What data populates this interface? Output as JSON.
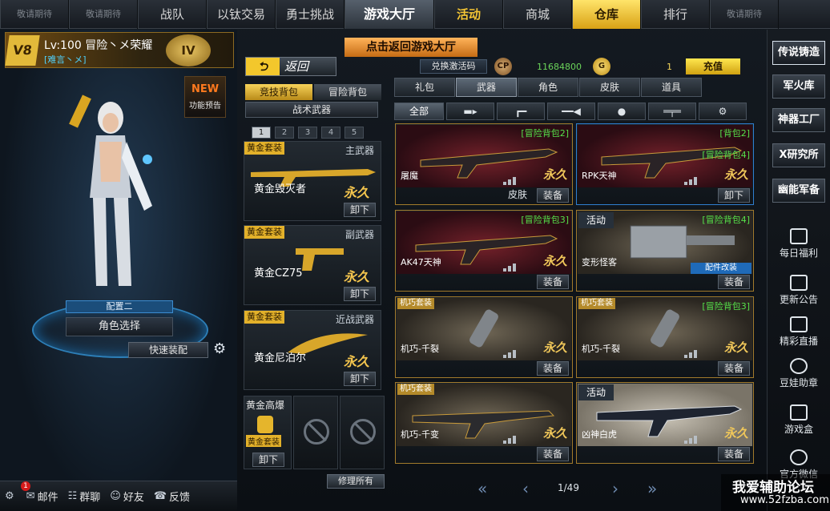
{
  "nav": [
    "敬请期待",
    "敬请期待",
    "战队",
    "以钛交易",
    "勇士挑战",
    "游戏大厅",
    "活动",
    "商城",
    "仓库",
    "排行",
    "敬请期待"
  ],
  "player": {
    "vip": "V8",
    "level": "Lv:100 冒险丶メ荣耀",
    "tag": "[难言丶メ]",
    "rank_badge": "IV"
  },
  "new_feature": {
    "new": "NEW",
    "label": "功能预告"
  },
  "config_label": "配置二",
  "role_select": "角色选择",
  "quick_equip": "快速装配",
  "bottom": {
    "badge_count": "1",
    "mail": "邮件",
    "group_chat": "群聊",
    "friends": "好友",
    "feedback": "反馈"
  },
  "hall_button": "点击返回游戏大厅",
  "back_button": "返回",
  "bags": {
    "competitive": "竞技背包",
    "adventure": "冒险背包"
  },
  "tactical_weapon": "战术武器",
  "pages": [
    "1",
    "2",
    "3",
    "4",
    "5"
  ],
  "slots": [
    {
      "tag": "黄金套装",
      "type": "主武器",
      "name": "黄金毁灭者",
      "perm": "永久",
      "unequip": "卸下"
    },
    {
      "tag": "黄金套装",
      "type": "副武器",
      "name": "黄金CZ75",
      "perm": "永久",
      "unequip": "卸下"
    },
    {
      "tag": "黄金套装",
      "type": "近战武器",
      "name": "黄金尼泊尔",
      "perm": "永久",
      "unequip": "卸下"
    }
  ],
  "grenade": {
    "title": "黄金高爆",
    "tag": "黄金套装",
    "unequip": "卸下"
  },
  "repair_all": "修理所有",
  "code_redeem": "兑换激活码",
  "currency": {
    "cp": "CP",
    "cp_value": "11684800",
    "gp": "G",
    "gp_value": "1",
    "recharge": "充值"
  },
  "categories": [
    "礼包",
    "武器",
    "角色",
    "皮肤",
    "道具"
  ],
  "subcategories": [
    "全部",
    "rifle-icon",
    "pistol-icon",
    "knife-icon",
    "grenade-icon",
    "sniper-icon",
    "gear-icon"
  ],
  "items": [
    {
      "name": "屠魔",
      "tag": "[冒险背包2]",
      "tag2": "",
      "label": "",
      "perm": "永久",
      "b0": "皮肤",
      "b1": "装备"
    },
    {
      "name": "RPK天神",
      "tag": "[背包2]",
      "tag2": "[冒险背包4]",
      "label": "",
      "perm": "永久",
      "b0": "",
      "b1": "卸下"
    },
    {
      "name": "AK47天神",
      "tag": "[冒险背包3]",
      "tag2": "",
      "label": "",
      "perm": "永久",
      "b0": "",
      "b1": "装备"
    },
    {
      "name": "变形怪客",
      "tag": "[冒险背包4]",
      "tag2": "",
      "label": "活动",
      "perm": "",
      "b0": "",
      "b1": "装备",
      "mod": "配件改装"
    },
    {
      "name": "机巧-千裂",
      "tag": "",
      "tag2": "",
      "label": "机巧套装",
      "perm": "永久",
      "b0": "",
      "b1": "装备"
    },
    {
      "name": "机巧-千裂",
      "tag": "[冒险背包3]",
      "tag2": "",
      "label": "机巧套装",
      "perm": "永久",
      "b0": "",
      "b1": "装备"
    },
    {
      "name": "机巧-千变",
      "tag": "",
      "tag2": "",
      "label": "机巧套装",
      "perm": "永久",
      "b0": "",
      "b1": "装备"
    },
    {
      "name": "凶神白虎",
      "tag": "",
      "tag2": "",
      "label": "活动",
      "perm": "永久",
      "b0": "",
      "b1": "装备"
    }
  ],
  "pager": {
    "text": "1/49"
  },
  "sidebar_buttons": [
    "传说铸造",
    "军火库",
    "神器工厂",
    "X研究所",
    "幽能军备"
  ],
  "sidebar_items": [
    "每日福利",
    "更新公告",
    "精彩直播",
    "豆娃助章",
    "游戏盒",
    "官方微信"
  ],
  "watermark": {
    "line1": "我爱辅助论坛",
    "line2": "www.52fzba.com"
  }
}
